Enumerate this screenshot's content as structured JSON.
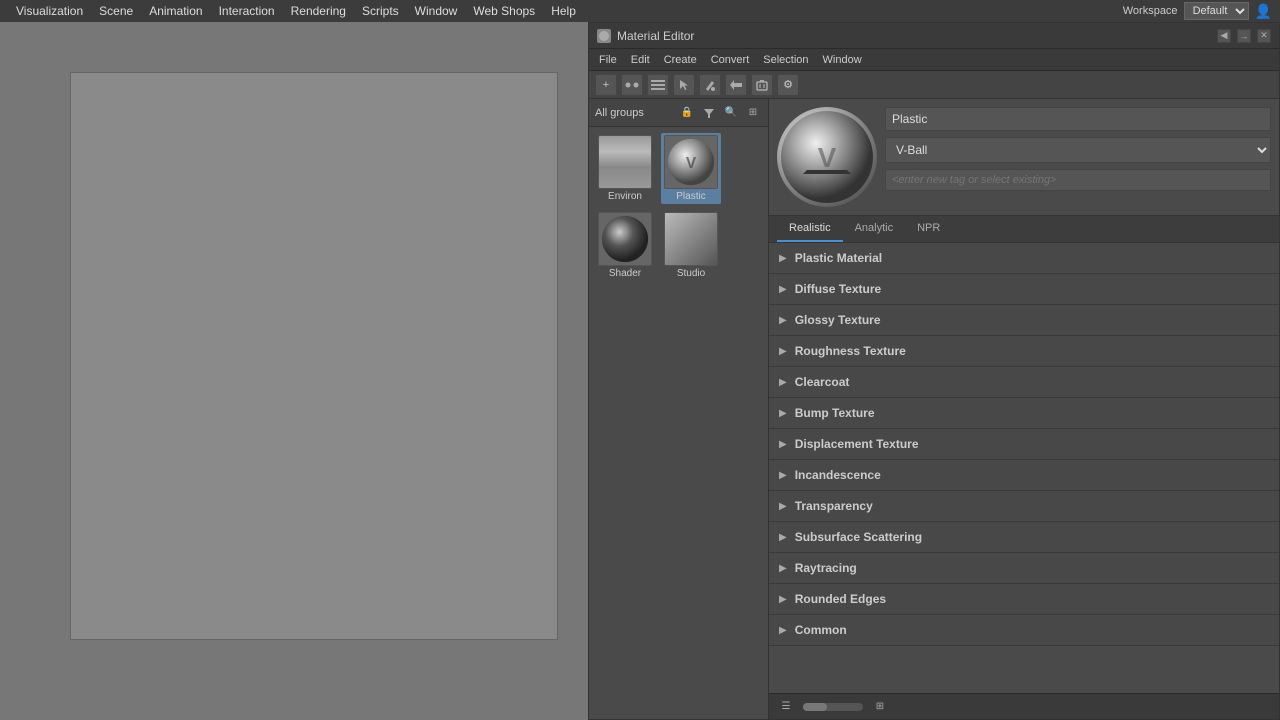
{
  "menubar": {
    "items": [
      "Visualization",
      "Scene",
      "Animation",
      "Interaction",
      "Rendering",
      "Scripts",
      "Window",
      "Web Shops",
      "Help"
    ]
  },
  "workspace": {
    "label": "Workspace",
    "value": "Default"
  },
  "material_editor": {
    "title": "Material Editor",
    "menus": [
      "File",
      "Edit",
      "Create",
      "Convert",
      "Selection",
      "Window"
    ],
    "groups_label": "All groups",
    "material_name": "Plastic",
    "preview_shape": "V-Ball",
    "tag_placeholder": "<enter new tag or select existing>",
    "tabs": [
      "Realistic",
      "Analytic",
      "NPR"
    ],
    "active_tab": "Realistic",
    "sections": [
      {
        "label": "Plastic Material"
      },
      {
        "label": "Diffuse Texture"
      },
      {
        "label": "Glossy Texture"
      },
      {
        "label": "Roughness Texture"
      },
      {
        "label": "Clearcoat"
      },
      {
        "label": "Bump Texture"
      },
      {
        "label": "Displacement Texture"
      },
      {
        "label": "Incandescence"
      },
      {
        "label": "Transparency"
      },
      {
        "label": "Subsurface Scattering"
      },
      {
        "label": "Raytracing"
      },
      {
        "label": "Rounded Edges"
      },
      {
        "label": "Common"
      }
    ],
    "mat_items": [
      {
        "label": "Environ",
        "type": "environ"
      },
      {
        "label": "Plastic",
        "type": "plastic",
        "selected": true
      },
      {
        "label": "Shader",
        "type": "shader"
      },
      {
        "label": "Studio",
        "type": "studio"
      }
    ]
  }
}
